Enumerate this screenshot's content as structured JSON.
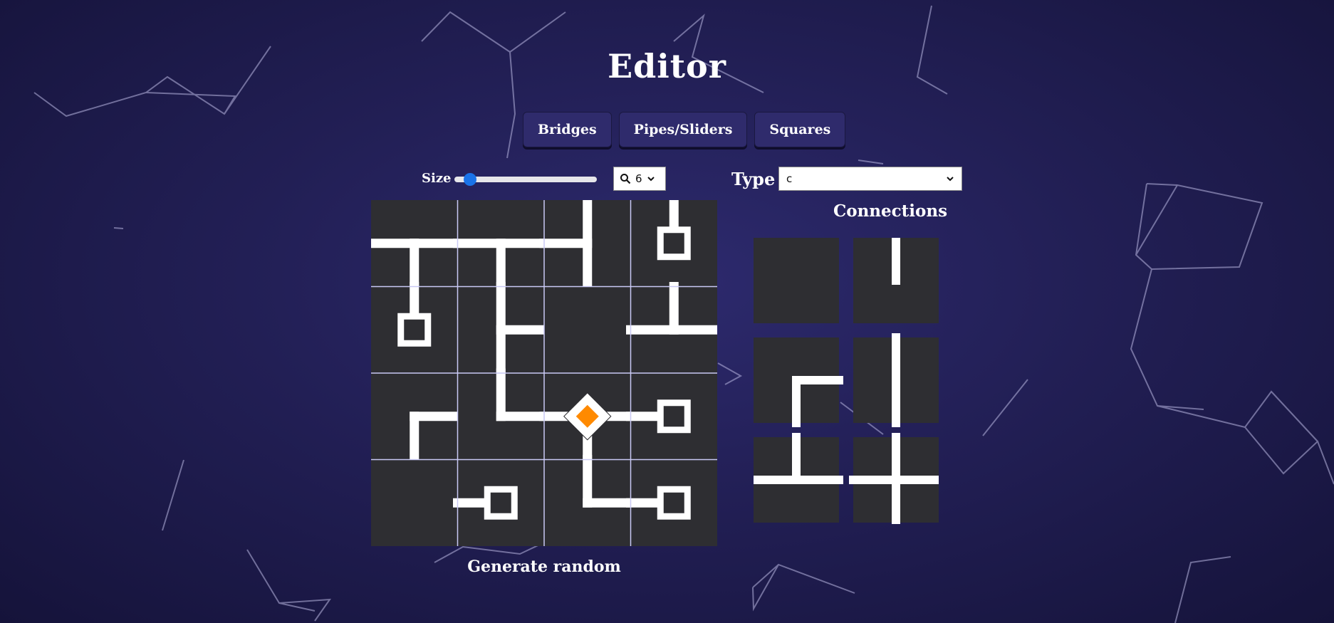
{
  "editor": {
    "title": "Editor"
  },
  "modes": [
    {
      "label": "Bridges"
    },
    {
      "label": "Pipes/Sliders"
    },
    {
      "label": "Squares"
    }
  ],
  "size": {
    "label": "Size",
    "slider_fraction": 0.07
  },
  "zoom": {
    "value": "6"
  },
  "type": {
    "label": "Type",
    "value": "c"
  },
  "connections": {
    "title": "Connections"
  },
  "actions": {
    "generate_label": "Generate random"
  },
  "colors": {
    "tile": "#2e2e32",
    "pipe": "#ffffff",
    "grid_line": "#c9c9f5",
    "goal": "#ff8a00"
  },
  "board": {
    "rows": 4,
    "cols": 4,
    "tiles": [
      [
        {
          "pipes": [
            [
              0,
              0.5,
              0.5,
              0.5
            ],
            [
              0.5,
              0.5,
              0.5,
              1
            ],
            [
              0.5,
              0.5,
              1,
              0.5
            ]
          ]
        },
        {
          "pipes": [
            [
              0,
              0.5,
              1,
              0.5
            ],
            [
              0.5,
              0.5,
              0.5,
              1
            ]
          ]
        },
        {
          "pipes": [
            [
              0,
              0.5,
              0.5,
              0.5
            ],
            [
              0.5,
              0,
              0.5,
              1
            ]
          ]
        },
        {
          "pipes": [
            [
              0.5,
              0,
              0.5,
              0.5
            ]
          ],
          "node": "square"
        }
      ],
      [
        {
          "pipes": [
            [
              0.5,
              0,
              0.5,
              0.5
            ]
          ],
          "node": "square"
        },
        {
          "pipes": [
            [
              0.5,
              0,
              0.5,
              1
            ],
            [
              0.5,
              0.5,
              1,
              0.5
            ]
          ]
        },
        {
          "pipes": []
        },
        {
          "pipes": [
            [
              0,
              0.5,
              1,
              0.5
            ],
            [
              0.5,
              0,
              0.5,
              0.5
            ]
          ]
        }
      ],
      [
        {
          "pipes": [
            [
              0.5,
              0.5,
              1,
              0.5
            ],
            [
              0.5,
              0.5,
              0.5,
              1
            ]
          ]
        },
        {
          "pipes": [
            [
              0.5,
              0,
              0.5,
              0.5
            ],
            [
              0.5,
              0.5,
              1,
              0.5
            ]
          ]
        },
        {
          "pipes": [
            [
              0,
              0.5,
              1,
              0.5
            ],
            [
              0.5,
              0.5,
              0.5,
              1
            ]
          ],
          "node": "diamond"
        },
        {
          "pipes": [
            [
              0,
              0.5,
              0.5,
              0.5
            ]
          ],
          "node": "square"
        }
      ],
      [
        {
          "pipes": []
        },
        {
          "pipes": [
            [
              0,
              0.5,
              0.5,
              0.5
            ]
          ],
          "node": "square"
        },
        {
          "pipes": [
            [
              0.5,
              0,
              0.5,
              0.5
            ],
            [
              0.5,
              0.5,
              1,
              0.5
            ]
          ]
        },
        {
          "pipes": [
            [
              0,
              0.5,
              0.5,
              0.5
            ]
          ],
          "node": "square"
        }
      ]
    ]
  },
  "connection_tiles": [
    {
      "pipes": []
    },
    {
      "pipes": [
        [
          0.5,
          0,
          0.5,
          0.5
        ]
      ]
    },
    {
      "pipes": [
        [
          0.5,
          0.5,
          1,
          0.5
        ],
        [
          0.5,
          0.5,
          0.5,
          1
        ]
      ]
    },
    {
      "pipes": [
        [
          0.5,
          0,
          0.5,
          1
        ]
      ]
    },
    {
      "pipes": [
        [
          0,
          0.5,
          1,
          0.5
        ],
        [
          0.5,
          0,
          0.5,
          0.5
        ]
      ]
    },
    {
      "pipes": [
        [
          0,
          0.5,
          1,
          0.5
        ],
        [
          0.5,
          0,
          0.5,
          1
        ]
      ]
    }
  ]
}
